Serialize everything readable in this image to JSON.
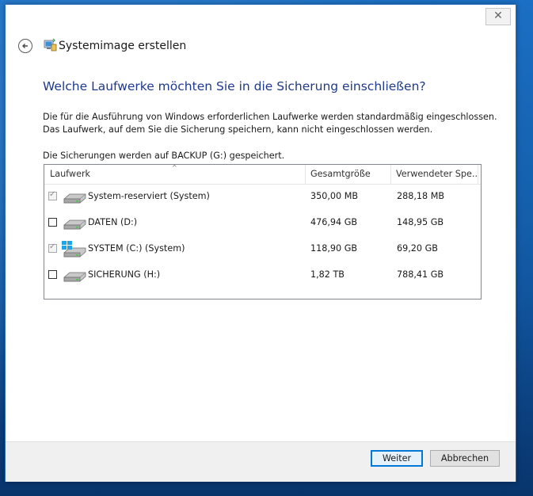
{
  "window": {
    "title": "Systemimage erstellen",
    "close_label": "✕"
  },
  "content": {
    "heading": "Welche Laufwerke möchten Sie in die Sicherung einschließen?",
    "description_line1": "Die für die Ausführung von Windows erforderlichen Laufwerke werden standardmäßig eingeschlossen.",
    "description_line2": "Das Laufwerk, auf dem Sie die Sicherung speichern, kann nicht eingeschlossen werden.",
    "save_info": "Die Sicherungen werden auf BACKUP (G:) gespeichert."
  },
  "table": {
    "columns": [
      "Laufwerk",
      "Gesamtgröße",
      "Verwendeter Spe..."
    ],
    "sorted_column": "Laufwerk",
    "rows": [
      {
        "name": "System-reserviert (System)",
        "total": "350,00 MB",
        "used": "288,18 MB",
        "checked": true,
        "disabled": true,
        "icon": "hard-drive-icon"
      },
      {
        "name": "DATEN (D:)",
        "total": "476,94 GB",
        "used": "148,95 GB",
        "checked": false,
        "disabled": false,
        "icon": "hard-drive-icon"
      },
      {
        "name": "SYSTEM (C:) (System)",
        "total": "118,90 GB",
        "used": "69,20 GB",
        "checked": true,
        "disabled": true,
        "icon": "windows-drive-icon"
      },
      {
        "name": "SICHERUNG (H:)",
        "total": "1,82 TB",
        "used": "788,41 GB",
        "checked": false,
        "disabled": false,
        "icon": "hard-drive-icon"
      }
    ]
  },
  "footer": {
    "next_label": "Weiter",
    "cancel_label": "Abbrechen"
  },
  "colors": {
    "heading": "#1e3a8c",
    "accent": "#0078d7",
    "desktop": "#1460ad"
  }
}
